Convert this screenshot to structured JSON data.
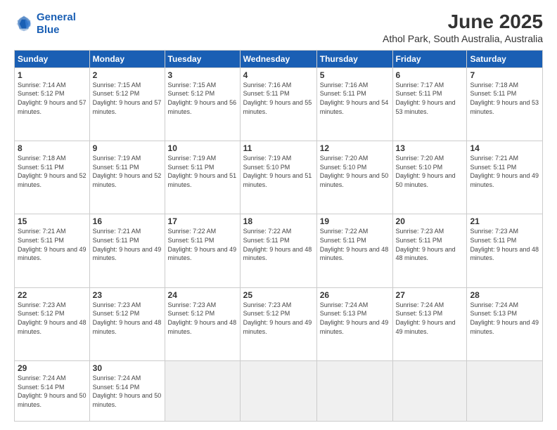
{
  "logo": {
    "line1": "General",
    "line2": "Blue"
  },
  "title": "June 2025",
  "subtitle": "Athol Park, South Australia, Australia",
  "weekdays": [
    "Sunday",
    "Monday",
    "Tuesday",
    "Wednesday",
    "Thursday",
    "Friday",
    "Saturday"
  ],
  "weeks": [
    [
      {
        "day": "1",
        "sunrise": "7:14 AM",
        "sunset": "5:12 PM",
        "daylight": "9 hours and 57 minutes."
      },
      {
        "day": "2",
        "sunrise": "7:15 AM",
        "sunset": "5:12 PM",
        "daylight": "9 hours and 57 minutes."
      },
      {
        "day": "3",
        "sunrise": "7:15 AM",
        "sunset": "5:12 PM",
        "daylight": "9 hours and 56 minutes."
      },
      {
        "day": "4",
        "sunrise": "7:16 AM",
        "sunset": "5:11 PM",
        "daylight": "9 hours and 55 minutes."
      },
      {
        "day": "5",
        "sunrise": "7:16 AM",
        "sunset": "5:11 PM",
        "daylight": "9 hours and 54 minutes."
      },
      {
        "day": "6",
        "sunrise": "7:17 AM",
        "sunset": "5:11 PM",
        "daylight": "9 hours and 53 minutes."
      },
      {
        "day": "7",
        "sunrise": "7:18 AM",
        "sunset": "5:11 PM",
        "daylight": "9 hours and 53 minutes."
      }
    ],
    [
      {
        "day": "8",
        "sunrise": "7:18 AM",
        "sunset": "5:11 PM",
        "daylight": "9 hours and 52 minutes."
      },
      {
        "day": "9",
        "sunrise": "7:19 AM",
        "sunset": "5:11 PM",
        "daylight": "9 hours and 52 minutes."
      },
      {
        "day": "10",
        "sunrise": "7:19 AM",
        "sunset": "5:11 PM",
        "daylight": "9 hours and 51 minutes."
      },
      {
        "day": "11",
        "sunrise": "7:19 AM",
        "sunset": "5:10 PM",
        "daylight": "9 hours and 51 minutes."
      },
      {
        "day": "12",
        "sunrise": "7:20 AM",
        "sunset": "5:10 PM",
        "daylight": "9 hours and 50 minutes."
      },
      {
        "day": "13",
        "sunrise": "7:20 AM",
        "sunset": "5:10 PM",
        "daylight": "9 hours and 50 minutes."
      },
      {
        "day": "14",
        "sunrise": "7:21 AM",
        "sunset": "5:11 PM",
        "daylight": "9 hours and 49 minutes."
      }
    ],
    [
      {
        "day": "15",
        "sunrise": "7:21 AM",
        "sunset": "5:11 PM",
        "daylight": "9 hours and 49 minutes."
      },
      {
        "day": "16",
        "sunrise": "7:21 AM",
        "sunset": "5:11 PM",
        "daylight": "9 hours and 49 minutes."
      },
      {
        "day": "17",
        "sunrise": "7:22 AM",
        "sunset": "5:11 PM",
        "daylight": "9 hours and 49 minutes."
      },
      {
        "day": "18",
        "sunrise": "7:22 AM",
        "sunset": "5:11 PM",
        "daylight": "9 hours and 48 minutes."
      },
      {
        "day": "19",
        "sunrise": "7:22 AM",
        "sunset": "5:11 PM",
        "daylight": "9 hours and 48 minutes."
      },
      {
        "day": "20",
        "sunrise": "7:23 AM",
        "sunset": "5:11 PM",
        "daylight": "9 hours and 48 minutes."
      },
      {
        "day": "21",
        "sunrise": "7:23 AM",
        "sunset": "5:11 PM",
        "daylight": "9 hours and 48 minutes."
      }
    ],
    [
      {
        "day": "22",
        "sunrise": "7:23 AM",
        "sunset": "5:12 PM",
        "daylight": "9 hours and 48 minutes."
      },
      {
        "day": "23",
        "sunrise": "7:23 AM",
        "sunset": "5:12 PM",
        "daylight": "9 hours and 48 minutes."
      },
      {
        "day": "24",
        "sunrise": "7:23 AM",
        "sunset": "5:12 PM",
        "daylight": "9 hours and 48 minutes."
      },
      {
        "day": "25",
        "sunrise": "7:23 AM",
        "sunset": "5:12 PM",
        "daylight": "9 hours and 49 minutes."
      },
      {
        "day": "26",
        "sunrise": "7:24 AM",
        "sunset": "5:13 PM",
        "daylight": "9 hours and 49 minutes."
      },
      {
        "day": "27",
        "sunrise": "7:24 AM",
        "sunset": "5:13 PM",
        "daylight": "9 hours and 49 minutes."
      },
      {
        "day": "28",
        "sunrise": "7:24 AM",
        "sunset": "5:13 PM",
        "daylight": "9 hours and 49 minutes."
      }
    ],
    [
      {
        "day": "29",
        "sunrise": "7:24 AM",
        "sunset": "5:14 PM",
        "daylight": "9 hours and 50 minutes."
      },
      {
        "day": "30",
        "sunrise": "7:24 AM",
        "sunset": "5:14 PM",
        "daylight": "9 hours and 50 minutes."
      },
      null,
      null,
      null,
      null,
      null
    ]
  ]
}
